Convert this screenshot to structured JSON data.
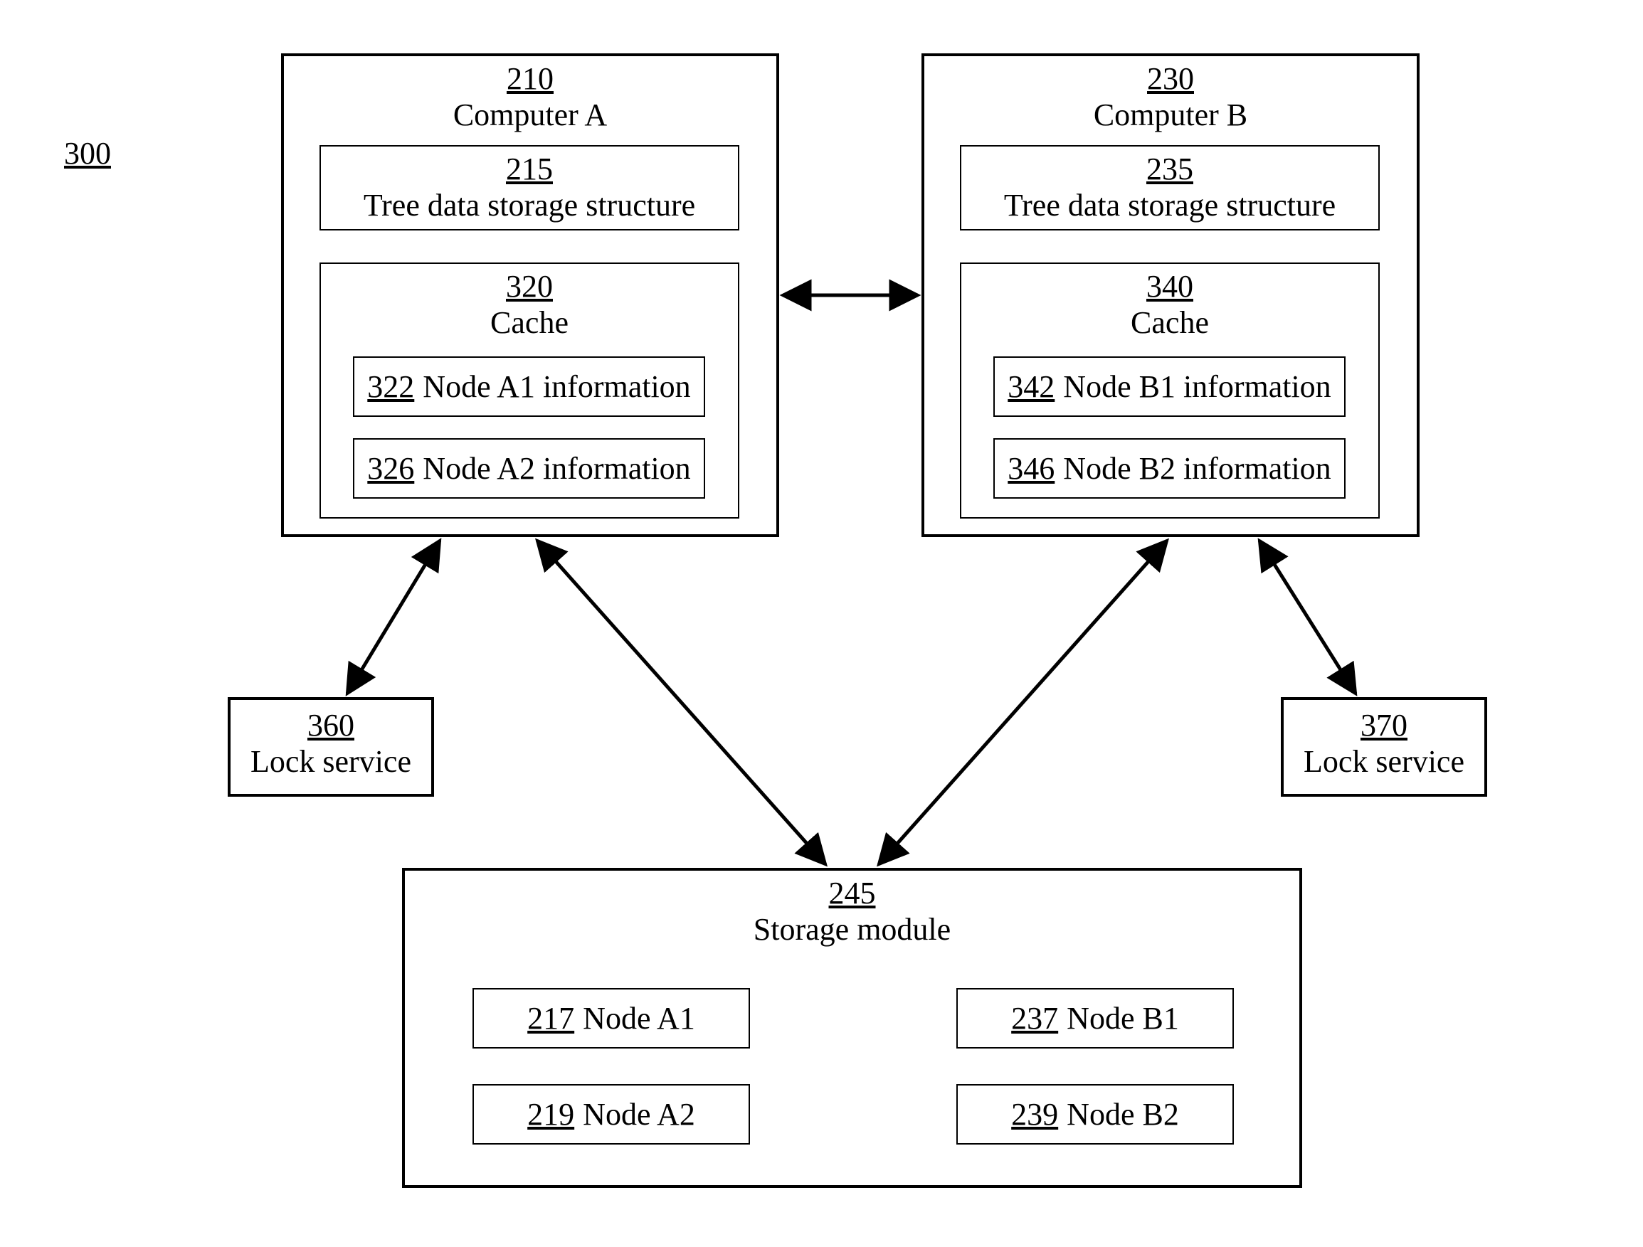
{
  "figure_ref": "300",
  "computer_a": {
    "ref": "210",
    "label": "Computer A",
    "tree": {
      "ref": "215",
      "label": "Tree data storage structure"
    },
    "cache": {
      "ref": "320",
      "label": "Cache",
      "node1": {
        "ref": "322",
        "label": "Node A1 information"
      },
      "node2": {
        "ref": "326",
        "label": "Node A2 information"
      }
    }
  },
  "computer_b": {
    "ref": "230",
    "label": "Computer B",
    "tree": {
      "ref": "235",
      "label": "Tree data storage structure"
    },
    "cache": {
      "ref": "340",
      "label": "Cache",
      "node1": {
        "ref": "342",
        "label": "Node B1 information"
      },
      "node2": {
        "ref": "346",
        "label": "Node B2 information"
      }
    }
  },
  "lock_a": {
    "ref": "360",
    "label": "Lock service"
  },
  "lock_b": {
    "ref": "370",
    "label": "Lock service"
  },
  "storage": {
    "ref": "245",
    "label": "Storage module",
    "a1": {
      "ref": "217",
      "label": "Node A1"
    },
    "a2": {
      "ref": "219",
      "label": "Node A2"
    },
    "b1": {
      "ref": "237",
      "label": "Node B1"
    },
    "b2": {
      "ref": "239",
      "label": "Node B2"
    }
  }
}
